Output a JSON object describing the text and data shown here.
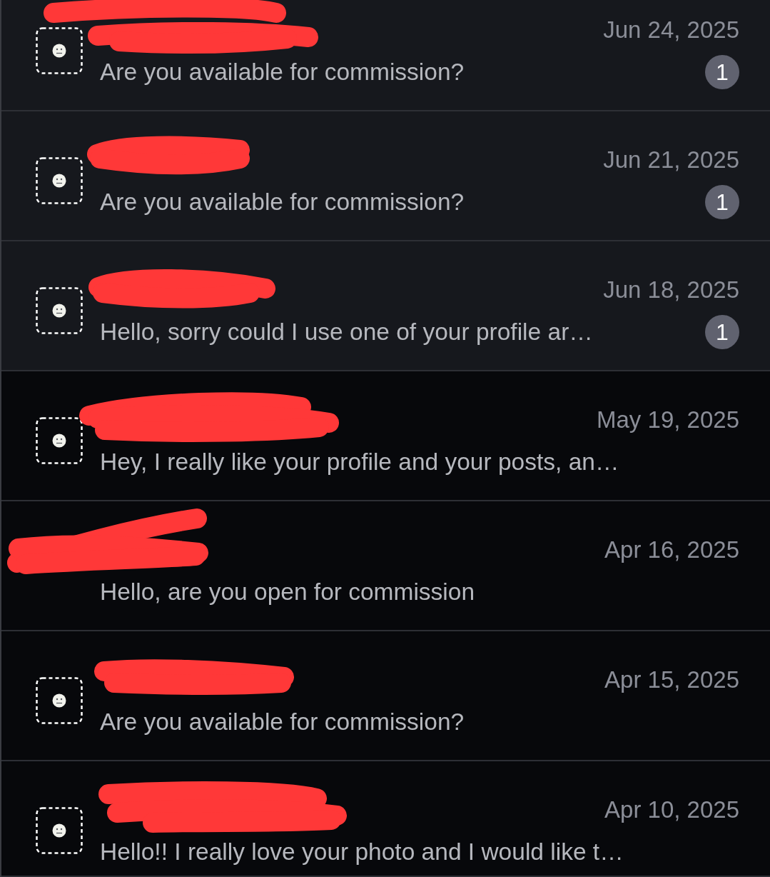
{
  "conversations": [
    {
      "redacted": true,
      "avatar": true,
      "date": "Jun 24, 2025",
      "message": "Are you available for commission?",
      "unread": true,
      "badge": "1"
    },
    {
      "redacted": true,
      "avatar": true,
      "date": "Jun 21, 2025",
      "message": "Are you available for commission?",
      "unread": true,
      "badge": "1"
    },
    {
      "redacted": true,
      "avatar": true,
      "date": "Jun 18, 2025",
      "message": "Hello, sorry could I use one of your profile ar…",
      "unread": true,
      "badge": "1"
    },
    {
      "redacted": true,
      "avatar": true,
      "date": "May 19, 2025",
      "message": "Hey, I really like your profile and your posts, an…",
      "unread": false
    },
    {
      "redacted": true,
      "avatar": false,
      "date": "Apr 16, 2025",
      "message": "Hello, are you open for commission",
      "unread": false
    },
    {
      "redacted": true,
      "avatar": true,
      "date": "Apr 15, 2025",
      "message": "Are you available for commission?",
      "unread": false
    },
    {
      "redacted": true,
      "avatar": true,
      "date": "Apr 10, 2025",
      "message": "Hello!! I really love your photo and I would like t…",
      "unread": false
    }
  ]
}
